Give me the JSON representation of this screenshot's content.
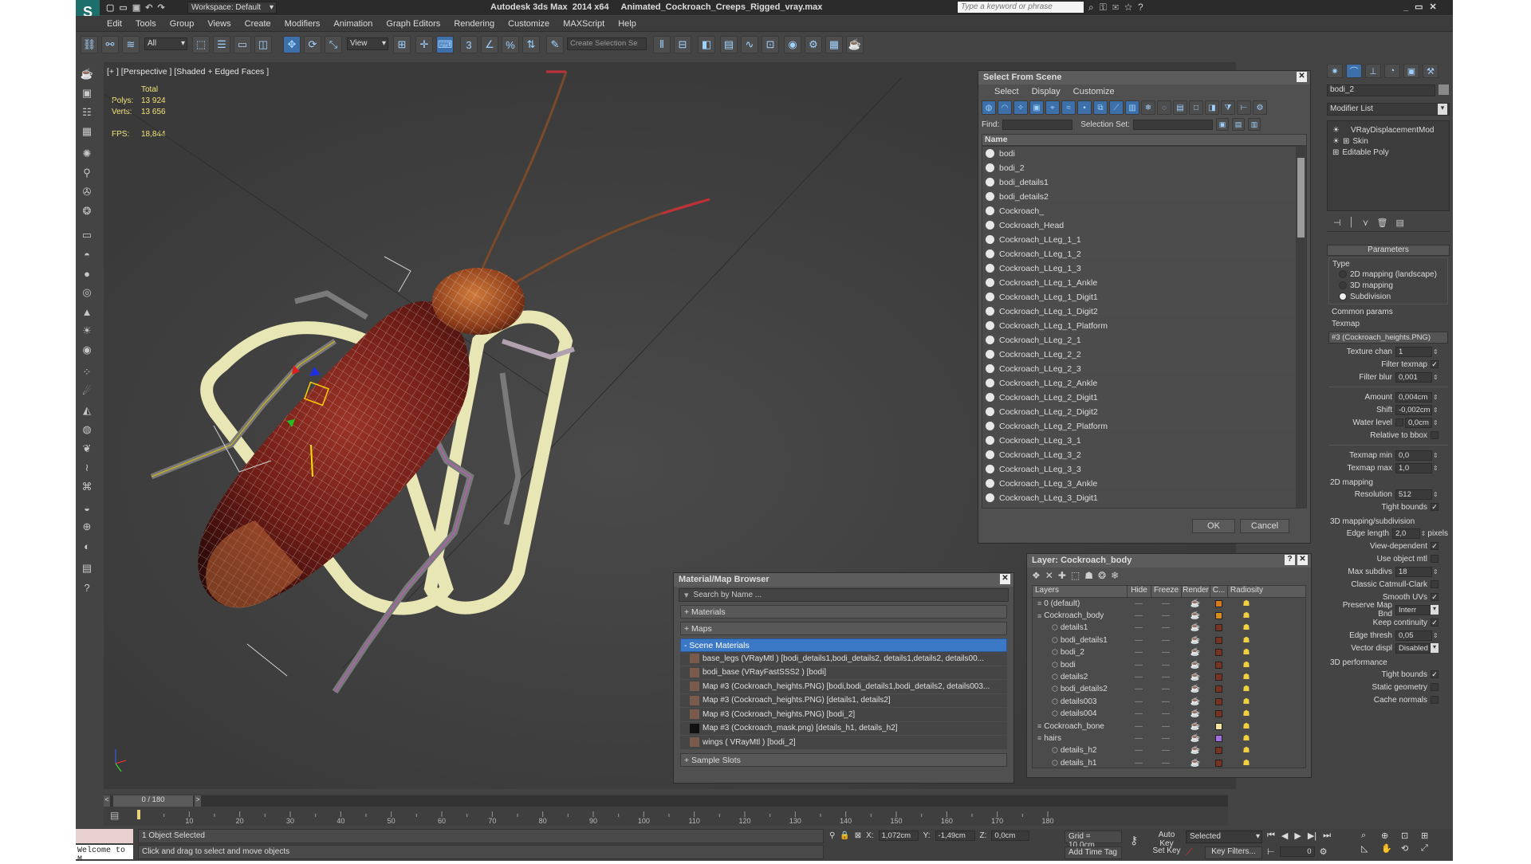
{
  "app": {
    "workspace": "Workspace: Default",
    "title": "Autodesk 3ds Max  2014 x64     Animated_Cockroach_Creeps_Rigged_vray.max",
    "search_placeholder": "Type a keyword or phrase"
  },
  "menu": [
    "Edit",
    "Tools",
    "Group",
    "Views",
    "Create",
    "Modifiers",
    "Animation",
    "Graph Editors",
    "Rendering",
    "Customize",
    "MAXScript",
    "Help"
  ],
  "toolbar": {
    "filter": "All",
    "ref_coord": "View",
    "selection_set": "Create Selection Se"
  },
  "viewport": {
    "label": "[+ ] [Perspective ] [Shaded + Edged Faces ]",
    "total_label": "Total",
    "polys_label": "Polys:",
    "polys_value": "13 924",
    "verts_label": "Verts:",
    "verts_value": "13 656",
    "fps_label": "FPS:",
    "fps_value": "18,844"
  },
  "select_scene": {
    "title": "Select From Scene",
    "menu": [
      "Select",
      "Display",
      "Customize"
    ],
    "find_label": "Find:",
    "selection_set_label": "Selection Set:",
    "col_name": "Name",
    "items": [
      "bodi",
      "bodi_2",
      "bodi_details1",
      "bodi_details2",
      "Cockroach_",
      "Cockroach_Head",
      "Cockroach_LLeg_1_1",
      "Cockroach_LLeg_1_2",
      "Cockroach_LLeg_1_3",
      "Cockroach_LLeg_1_Ankle",
      "Cockroach_LLeg_1_Digit1",
      "Cockroach_LLeg_1_Digit2",
      "Cockroach_LLeg_1_Platform",
      "Cockroach_LLeg_2_1",
      "Cockroach_LLeg_2_2",
      "Cockroach_LLeg_2_3",
      "Cockroach_LLeg_2_Ankle",
      "Cockroach_LLeg_2_Digit1",
      "Cockroach_LLeg_2_Digit2",
      "Cockroach_LLeg_2_Platform",
      "Cockroach_LLeg_3_1",
      "Cockroach_LLeg_3_2",
      "Cockroach_LLeg_3_3",
      "Cockroach_LLeg_3_Ankle",
      "Cockroach_LLeg_3_Digit1"
    ],
    "ok": "OK",
    "cancel": "Cancel"
  },
  "material_browser": {
    "title": "Material/Map Browser",
    "search_placeholder": "Search by Name ...",
    "materials": "+ Materials",
    "maps": "+ Maps",
    "scene_materials": "- Scene Materials",
    "entries": [
      "base_legs (VRayMtl ) [bodi_details1,bodi_details2, details1,details2, details00...",
      "bodi_base  (VRayFastSSS2 ) [bodi]",
      "Map #3 (Cockroach_heights.PNG) [bodi,bodi_details1,bodi_details2, details003...",
      "Map #3 (Cockroach_heights.PNG) [details1, details2]",
      "Map #3 (Cockroach_heights.PNG) [bodi_2]",
      "Map #3 (Cockroach_mask.png) [details_h1, details_h2]",
      "wings  ( VRayMtl ) [bodi_2]"
    ],
    "sample_slots": "+ Sample Slots"
  },
  "layer_dialog": {
    "title": "Layer: Cockroach_body",
    "cols": [
      "Layers",
      "Hide",
      "Freeze",
      "Render",
      "C...",
      "Radiosity"
    ],
    "rows": [
      {
        "name": "0 (default)",
        "indent": 1
      },
      {
        "name": "Cockroach_body",
        "indent": 1
      },
      {
        "name": "details1",
        "indent": 2
      },
      {
        "name": "bodi_details1",
        "indent": 2
      },
      {
        "name": "bodi_2",
        "indent": 2
      },
      {
        "name": "bodi",
        "indent": 2
      },
      {
        "name": "details2",
        "indent": 2
      },
      {
        "name": "bodi_details2",
        "indent": 2
      },
      {
        "name": "details003",
        "indent": 2
      },
      {
        "name": "details004",
        "indent": 2
      },
      {
        "name": "Cockroach_bone",
        "indent": 1
      },
      {
        "name": "hairs",
        "indent": 1
      },
      {
        "name": "details_h2",
        "indent": 2
      },
      {
        "name": "details_h1",
        "indent": 2
      }
    ],
    "layer_colors": [
      "#d97a1a",
      "#d98c1a",
      "#7a3322",
      "#7a3322",
      "#7a3322",
      "#7a3322",
      "#7a3322",
      "#7a3322",
      "#7a3322",
      "#7a3322",
      "#f3e4a0",
      "#a070e0",
      "#7a3322",
      "#7a3322"
    ]
  },
  "command_panel": {
    "object_name": "bodi_2",
    "modifier_list": "Modifier List",
    "stack": [
      "VRayDisplacementMod",
      "Skin",
      "Editable Poly"
    ],
    "rollout": "Parameters",
    "type_label": "Type",
    "type_options": [
      "2D mapping (landscape)",
      "3D mapping",
      "Subdivision"
    ],
    "common_params": "Common params",
    "texmap_label": "Texmap",
    "texmap_value": "#3 (Cockroach_heights.PNG)",
    "texture_chan_label": "Texture chan",
    "texture_chan": "1",
    "filter_texmap": "Filter texmap",
    "filter_blur_label": "Filter blur",
    "filter_blur": "0,001",
    "amount_label": "Amount",
    "amount": "0,004cm",
    "shift_label": "Shift",
    "shift": "-0,002cm",
    "water_level_label": "Water level",
    "water_level": "0,0cm",
    "relative_bbox": "Relative to bbox",
    "texmap_min_label": "Texmap min",
    "texmap_min": "0,0",
    "texmap_max_label": "Texmap max",
    "texmap_max": "1,0",
    "mapping2d": "2D mapping",
    "resolution_label": "Resolution",
    "resolution": "512",
    "tight_bounds": "Tight bounds",
    "mapping3d": "3D mapping/subdivision",
    "edge_length_label": "Edge length",
    "edge_length": "2,0",
    "pixels": "pixels",
    "view_dependent": "View-dependent",
    "use_object_mtl": "Use object mtl",
    "max_subdivs_label": "Max subdivs",
    "max_subdivs": "18",
    "classic_catmull": "Classic Catmull-Clark",
    "smooth_uvs": "Smooth UVs",
    "preserve_map_label": "Preserve Map Bnd",
    "preserve_map": "Interr",
    "keep_continuity": "Keep continuity",
    "edge_thresh_label": "Edge thresh",
    "edge_thresh": "0,05",
    "vector_displ_label": "Vector displ",
    "vector_displ": "Disabled",
    "perf3d": "3D performance",
    "tight_bounds2": "Tight bounds",
    "static_geometry": "Static geometry",
    "cache_normals": "Cache normals"
  },
  "timeline": {
    "frame": "0 / 180",
    "ticks": [
      "10",
      "20",
      "30",
      "40",
      "50",
      "60",
      "70",
      "80",
      "90",
      "100",
      "110",
      "120",
      "130",
      "140",
      "150",
      "160",
      "170",
      "180"
    ]
  },
  "status": {
    "objects": "1 Object Selected",
    "prompt": "Click and drag to select and move objects",
    "listener": "Welcome to M",
    "x_label": "X:",
    "x": "1,072cm",
    "y_label": "Y:",
    "y": "-1,49cm",
    "z_label": "Z:",
    "z": "0,0cm",
    "grid": "Grid = 10,0cm",
    "auto_key": "Auto Key",
    "set_key": "Set Key",
    "selected": "Selected",
    "key_filters": "Key Filters...",
    "add_time_tag": "Add Time Tag",
    "frame_field": "0"
  }
}
